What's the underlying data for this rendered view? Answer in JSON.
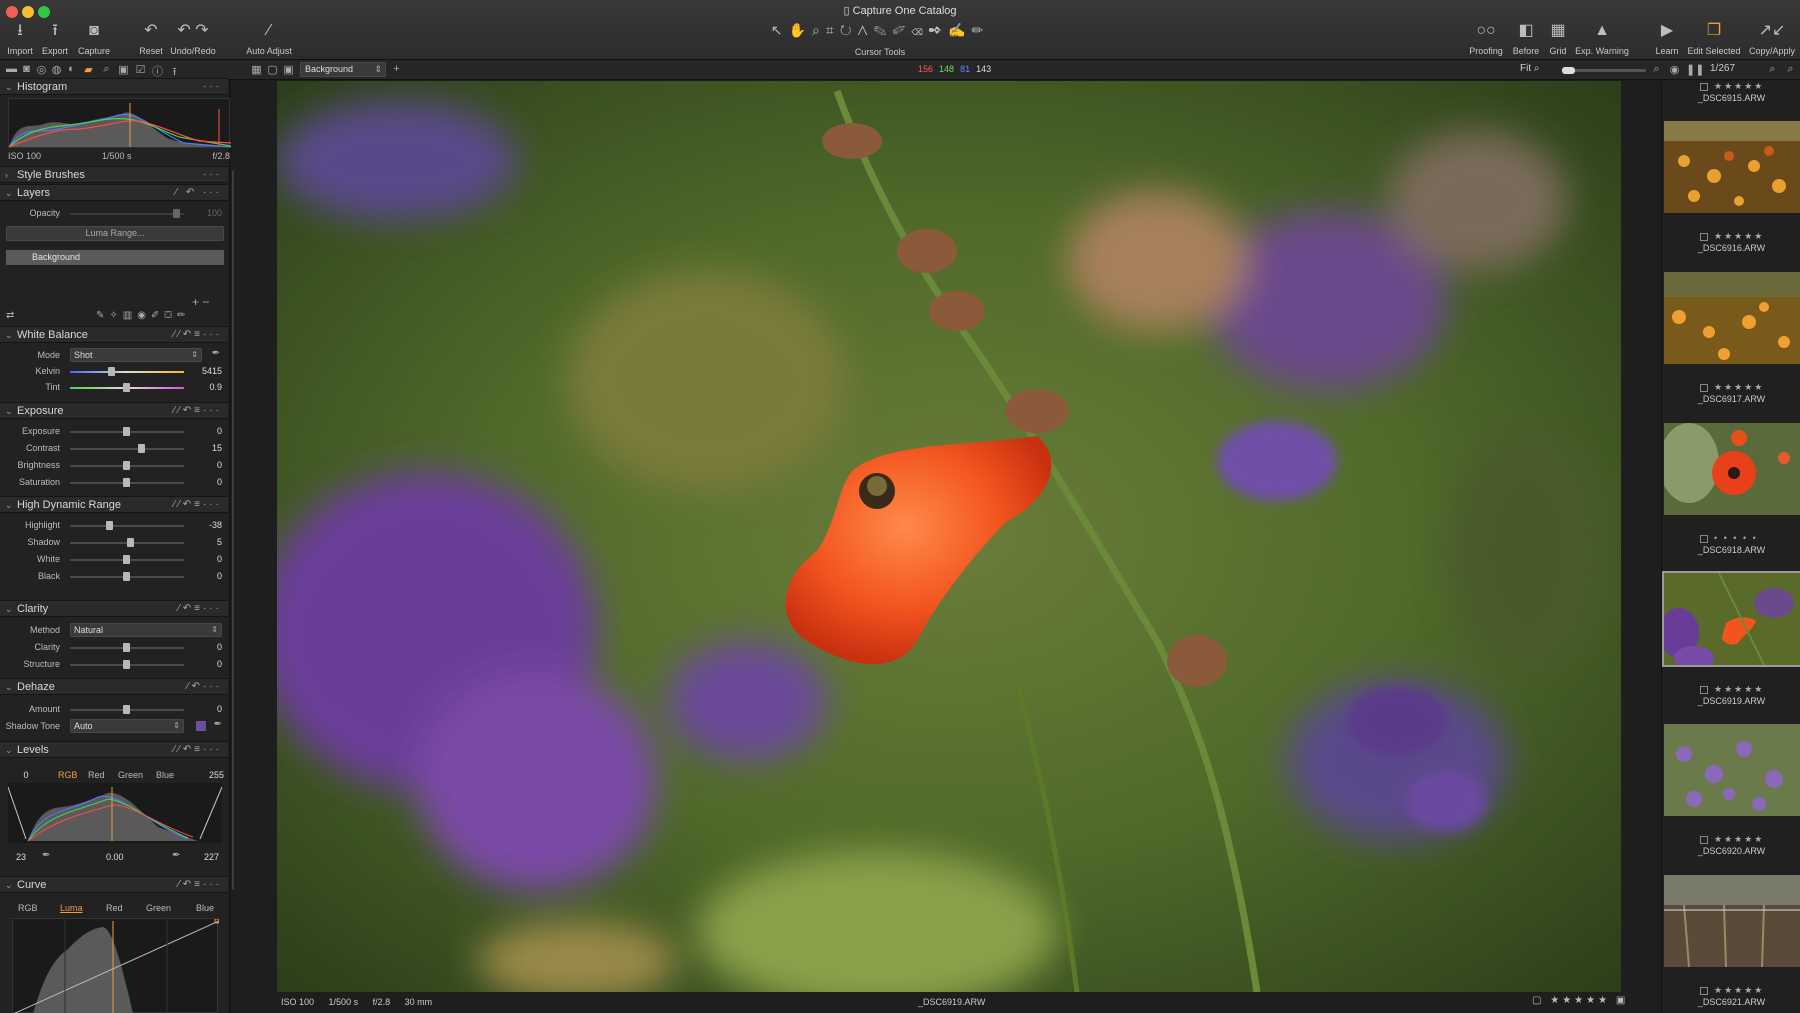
{
  "window": {
    "title": "Capture One Catalog"
  },
  "toolbar": {
    "import": "Import",
    "export": "Export",
    "capture": "Capture",
    "reset": "Reset",
    "undo_redo": "Undo/Redo",
    "auto_adjust": "Auto Adjust",
    "cursor_tools": "Cursor Tools",
    "proofing": "Proofing",
    "before": "Before",
    "grid": "Grid",
    "exp_warning": "Exp. Warning",
    "learn": "Learn",
    "edit_selected": "Edit Selected",
    "copy_apply": "Copy/Apply"
  },
  "subbar": {
    "layer": "Background",
    "r": "156",
    "g": "148",
    "b": "81",
    "a": "143",
    "fit": "Fit",
    "count": "1/267",
    "zoom_fraction": 0.15
  },
  "histogram": {
    "title": "Histogram",
    "iso": "ISO 100",
    "shutter": "1/500 s",
    "aperture": "f/2.8"
  },
  "style_brushes": {
    "title": "Style Brushes"
  },
  "layers": {
    "title": "Layers",
    "opacity_label": "Opacity",
    "opacity_value": "100",
    "luma_range": "Luma Range...",
    "background": "Background"
  },
  "white_balance": {
    "title": "White Balance",
    "mode_label": "Mode",
    "mode": "Shot",
    "kelvin_label": "Kelvin",
    "kelvin": "5415",
    "tint_label": "Tint",
    "tint": "0.9"
  },
  "exposure": {
    "title": "Exposure",
    "exposure_label": "Exposure",
    "exposure": "0",
    "contrast_label": "Contrast",
    "contrast": "15",
    "brightness_label": "Brightness",
    "brightness": "0",
    "saturation_label": "Saturation",
    "saturation": "0"
  },
  "hdr": {
    "title": "High Dynamic Range",
    "highlight_label": "Highlight",
    "highlight": "-38",
    "shadow_label": "Shadow",
    "shadow": "5",
    "white_label": "White",
    "white": "0",
    "black_label": "Black",
    "black": "0"
  },
  "clarity": {
    "title": "Clarity",
    "method_label": "Method",
    "method": "Natural",
    "clarity_label": "Clarity",
    "clarity": "0",
    "structure_label": "Structure",
    "structure": "0"
  },
  "dehaze": {
    "title": "Dehaze",
    "amount_label": "Amount",
    "amount": "0",
    "shadow_tone_label": "Shadow Tone",
    "shadow_tone": "Auto"
  },
  "levels": {
    "title": "Levels",
    "low": "0",
    "high": "255",
    "tabs": [
      "RGB",
      "Red",
      "Green",
      "Blue"
    ],
    "in_low": "23",
    "mid": "0.00",
    "in_high": "227"
  },
  "curve": {
    "title": "Curve",
    "tabs": [
      "RGB",
      "Luma",
      "Red",
      "Green",
      "Blue"
    ]
  },
  "status": {
    "iso": "ISO 100",
    "shutter": "1/500 s",
    "aperture": "f/2.8",
    "focal": "30 mm",
    "file": "_DSC6919.ARW",
    "stars": "★★★★★"
  },
  "filmstrip": [
    {
      "name": "_DSC6915.ARW",
      "stars": "★★★★★"
    },
    {
      "name": "_DSC6916.ARW",
      "stars": "★★★★★"
    },
    {
      "name": "_DSC6917.ARW",
      "stars": "★★★★★"
    },
    {
      "name": "_DSC6918.ARW",
      "stars": "• • • • •"
    },
    {
      "name": "_DSC6919.ARW",
      "stars": "★★★★★"
    },
    {
      "name": "_DSC6920.ARW",
      "stars": "★★★★★"
    },
    {
      "name": "_DSC6921.ARW",
      "stars": "★★★★★"
    }
  ],
  "colors": {
    "accent": "#f0a040",
    "red": "#ff5a5a",
    "green": "#6ddc5a",
    "blue": "#5a8cff"
  }
}
